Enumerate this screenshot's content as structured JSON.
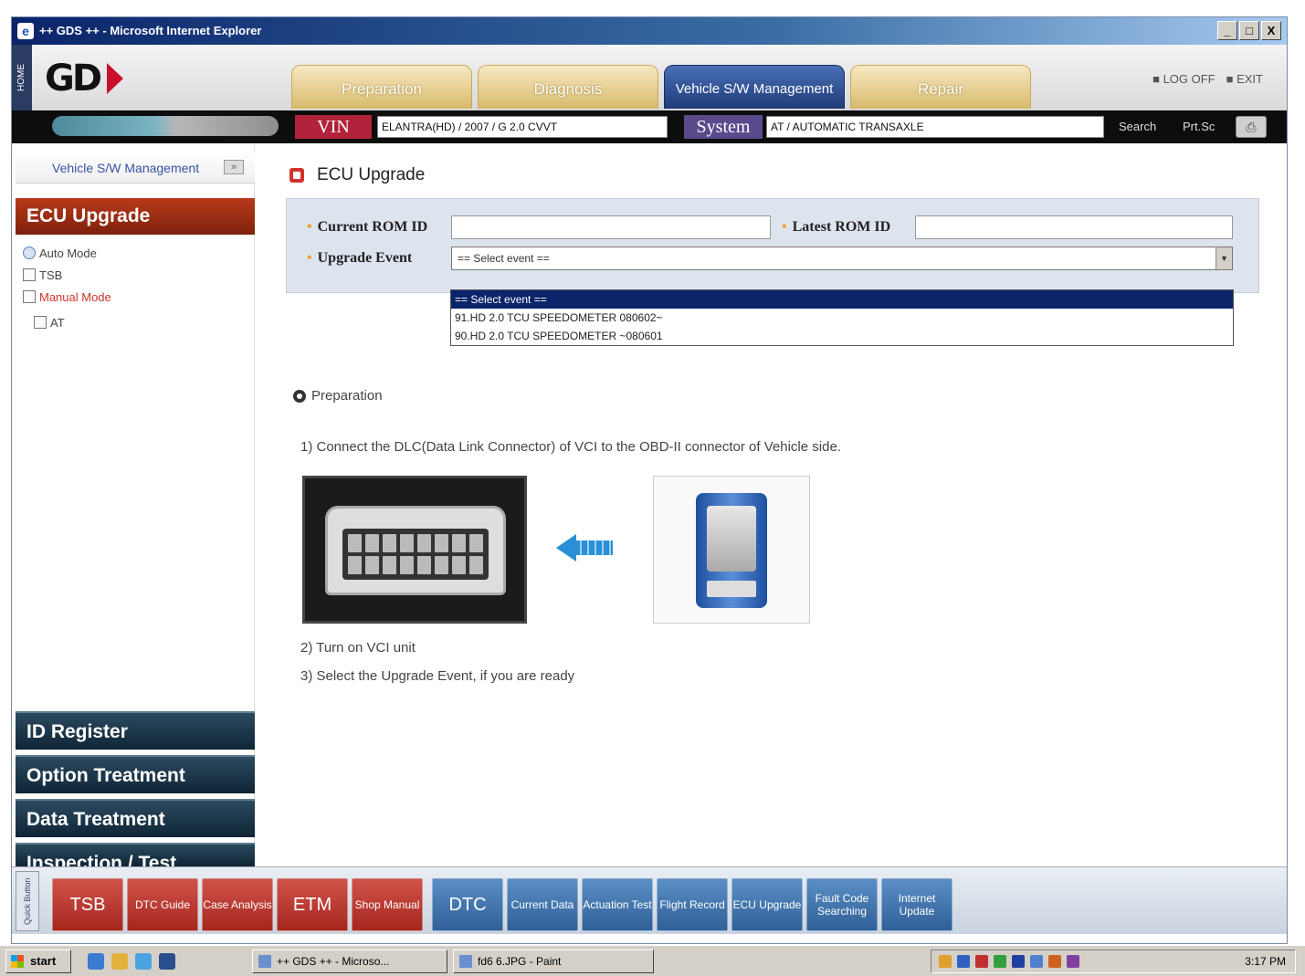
{
  "window": {
    "title": "++ GDS ++ - Microsoft Internet Explorer",
    "controls": [
      "_",
      "□",
      "X"
    ]
  },
  "header": {
    "home_label": "HOME",
    "logo_text": "GD",
    "tabs": [
      {
        "label": "Preparation",
        "active": false
      },
      {
        "label": "Diagnosis",
        "active": false
      },
      {
        "label": "Vehicle S/W Management",
        "active": true
      },
      {
        "label": "Repair",
        "active": false
      }
    ],
    "logoff": "LOG OFF",
    "exit": "EXIT"
  },
  "infobar": {
    "vin_label": "VIN",
    "vin_value": "ELANTRA(HD) / 2007 / G 2.0 CVVT",
    "system_label": "System",
    "system_value": "AT / AUTOMATIC TRANSAXLE",
    "search": "Search",
    "prtsc": "Prt.Sc"
  },
  "sidebar": {
    "header": "Vehicle S/W Management",
    "active_section": "ECU Upgrade",
    "tree": [
      {
        "label": "Auto Mode",
        "icon": "globe-icon",
        "red": false
      },
      {
        "label": "TSB",
        "icon": "document-icon",
        "red": false
      },
      {
        "label": "Manual Mode",
        "icon": "folder-icon",
        "red": true
      },
      {
        "label": "AT",
        "icon": "document-icon",
        "red": false,
        "sub": true
      }
    ],
    "nav": [
      {
        "label": "ID Register"
      },
      {
        "label": "Option Treatment"
      },
      {
        "label": "Data Treatment"
      },
      {
        "label": "Inspection / Test"
      }
    ]
  },
  "main": {
    "title": "ECU Upgrade",
    "current_rom_label": "Current ROM ID",
    "current_rom_value": "",
    "latest_rom_label": "Latest ROM ID",
    "latest_rom_value": "",
    "upgrade_event_label": "Upgrade Event",
    "upgrade_event_selected": "== Select event ==",
    "upgrade_event_options": [
      "== Select event ==",
      "91.HD 2.0 TCU SPEEDOMETER 080602~",
      "90.HD 2.0 TCU SPEEDOMETER ~080601"
    ],
    "preparation_heading": "Preparation",
    "step1": "1) Connect the DLC(Data Link Connector) of VCI to the OBD-II connector of Vehicle side.",
    "step2": "2) Turn on VCI unit",
    "step3": "3) Select the Upgrade Event, if you are ready"
  },
  "toolbar": {
    "side_label": "Quick Button",
    "buttons": [
      {
        "label": "TSB",
        "color": "red"
      },
      {
        "label": "DTC Guide",
        "color": "red"
      },
      {
        "label": "Case Analysis",
        "color": "red"
      },
      {
        "label": "ETM",
        "color": "red"
      },
      {
        "label": "Shop Manual",
        "color": "red"
      },
      {
        "label": "DTC",
        "color": "blue"
      },
      {
        "label": "Current Data",
        "color": "blue"
      },
      {
        "label": "Actuation Test",
        "color": "blue"
      },
      {
        "label": "Flight Record",
        "color": "blue"
      },
      {
        "label": "ECU Upgrade",
        "color": "blue"
      },
      {
        "label": "Fault Code Searching",
        "color": "blue"
      },
      {
        "label": "Internet Update",
        "color": "blue"
      }
    ]
  },
  "taskbar": {
    "start": "start",
    "tasks": [
      "++ GDS ++ - Microso...",
      "fd6 6.JPG - Paint"
    ],
    "clock": "3:17 PM"
  },
  "colors": {
    "brand_red": "#c8102e",
    "active_tab": "#1f3d7a",
    "sidebar_active": "#9c2d14",
    "nav_dark": "#1b3345"
  }
}
